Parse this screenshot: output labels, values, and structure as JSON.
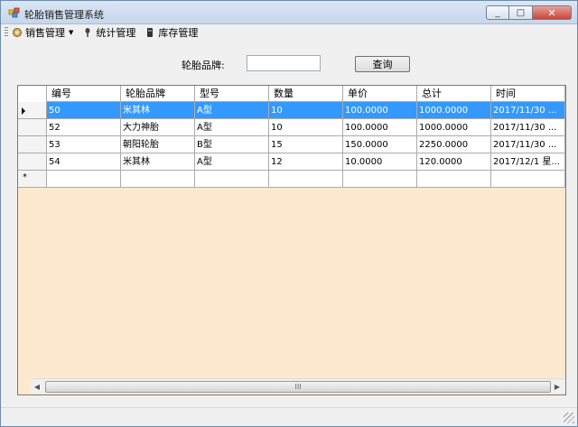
{
  "window": {
    "title": "轮胎销售管理系统",
    "close_glyph": "✕",
    "max_glyph": "□",
    "min_glyph": "_"
  },
  "menu": {
    "items": [
      {
        "label": "销售管理",
        "icon": "sales-icon",
        "has_dropdown": true
      },
      {
        "label": "统计管理",
        "icon": "stats-icon",
        "has_dropdown": false
      },
      {
        "label": "库存管理",
        "icon": "inventory-icon",
        "has_dropdown": false
      }
    ]
  },
  "search": {
    "label": "轮胎品牌:",
    "value": "",
    "button_label": "查询"
  },
  "table": {
    "columns": [
      "编号",
      "轮胎品牌",
      "型号",
      "数量",
      "单价",
      "总计",
      "时间"
    ],
    "rows": [
      [
        "50",
        "米其林",
        "A型",
        "10",
        "100.0000",
        "1000.0000",
        "2017/11/30 ..."
      ],
      [
        "52",
        "大力神胎",
        "A型",
        "10",
        "100.0000",
        "1000.0000",
        "2017/11/30 ..."
      ],
      [
        "53",
        "朝阳轮胎",
        "B型",
        "15",
        "150.0000",
        "2250.0000",
        "2017/11/30 ..."
      ],
      [
        "54",
        "米其林",
        "A型",
        "12",
        "10.0000",
        "120.0000",
        "2017/12/1 星..."
      ]
    ],
    "selected_row": 0,
    "new_row_marker": "*"
  },
  "scrollbar": {
    "thumb_glyph": "III",
    "left_glyph": "◀",
    "right_glyph": "▶"
  },
  "colors": {
    "selection": "#3399ff",
    "grid_background": "#fde9cd"
  }
}
